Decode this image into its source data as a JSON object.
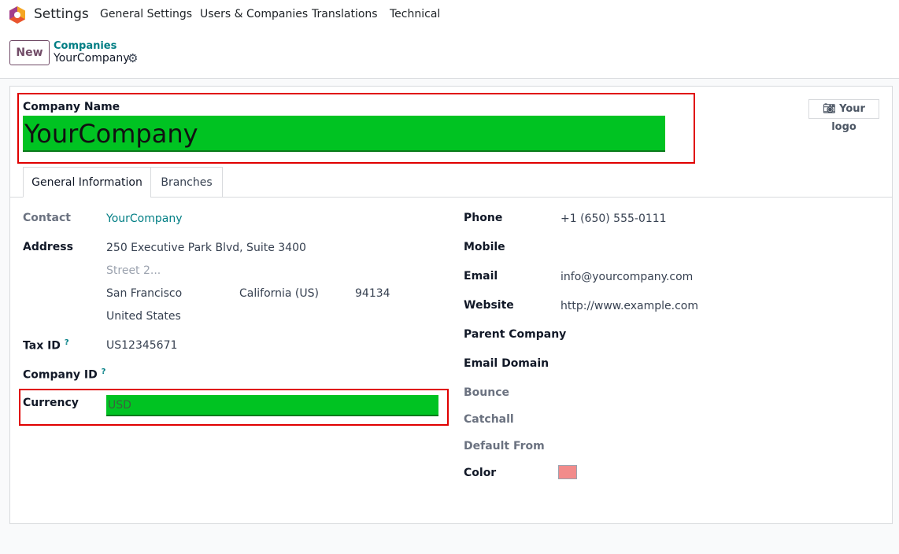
{
  "nav": {
    "app": "Settings",
    "menu": [
      "General Settings",
      "Users & Companies",
      "Translations",
      "Technical"
    ]
  },
  "control": {
    "new_label": "New",
    "breadcrumb_parent": "Companies",
    "breadcrumb_current": "YourCompany"
  },
  "form": {
    "company_name_label": "Company Name",
    "company_name": "YourCompany",
    "logo_label": "Your logo",
    "tabs": [
      "General Information",
      "Branches"
    ],
    "left": {
      "contact_label": "Contact",
      "contact": "YourCompany",
      "address_label": "Address",
      "street": "250 Executive Park Blvd, Suite 3400",
      "street2_placeholder": "Street 2...",
      "city": "San Francisco",
      "state": "California (US)",
      "zip": "94134",
      "country": "United States",
      "tax_label": "Tax ID",
      "tax": "US12345671",
      "company_id_label": "Company ID",
      "help": "?",
      "currency_label": "Currency",
      "currency": "USD"
    },
    "right": {
      "phone_label": "Phone",
      "phone": "+1 (650) 555-0111",
      "mobile_label": "Mobile",
      "email_label": "Email",
      "email": "info@yourcompany.com",
      "website_label": "Website",
      "website": "http://www.example.com",
      "parent_label": "Parent Company",
      "domain_label": "Email Domain",
      "bounce_label": "Bounce",
      "catchall_label": "Catchall",
      "default_from_label": "Default From",
      "color_label": "Color",
      "color": "#f28b8b"
    }
  },
  "colors": {
    "brand": "#714b67",
    "link": "#017e84",
    "highlight": "#00c322",
    "annotation": "#e00000"
  }
}
